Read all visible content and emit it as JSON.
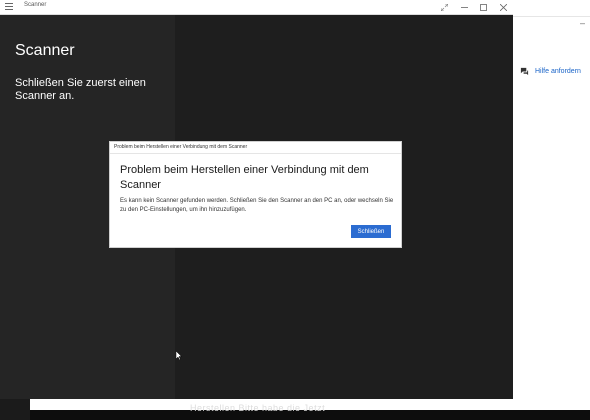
{
  "app": {
    "title": "Scanner",
    "heading": "Scanner",
    "message": "Schließen Sie zuerst einen Scanner an."
  },
  "dialog": {
    "title": "Problem beim Herstellen einer Verbindung mit dem Scanner",
    "heading": "Problem beim Herstellen einer Verbindung mit dem Scanner",
    "body": "Es kann kein Scanner gefunden werden. Schließen Sie den Scanner an den PC an, oder wechseln Sie zu den PC-Einstellungen, um ihn hinzuzufügen.",
    "close_label": "Schließen",
    "accent": "#2b6cd1"
  },
  "background": {
    "help_label": "Hilfe anfordern",
    "partial_text": "Herstellen Bitte habe die Jetzt"
  },
  "icons": {
    "menu": "hamburger-icon",
    "expand": "expand-icon",
    "minimize": "minimize-icon",
    "maximize": "maximize-icon",
    "close": "close-icon",
    "help": "chat-help-icon",
    "cursor": "mouse-cursor-icon"
  }
}
